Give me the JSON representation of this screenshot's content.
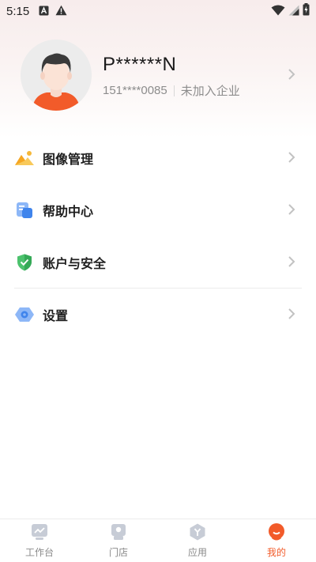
{
  "status_bar": {
    "time": "5:15",
    "left_icons": [
      "a-box-icon",
      "warning-icon"
    ],
    "right_icons": [
      "wifi-icon",
      "signal-icon",
      "battery-charging-icon"
    ]
  },
  "profile": {
    "name": "P******N",
    "phone": "151****0085",
    "company_status": "未加入企业"
  },
  "menu": {
    "items": [
      {
        "label": "图像管理",
        "icon": "image-icon",
        "color": "#f5b83a"
      },
      {
        "label": "帮助中心",
        "icon": "help-doc-icon",
        "color": "#4a8df0"
      },
      {
        "label": "账户与安全",
        "icon": "shield-icon",
        "color": "#3dbb5f"
      },
      {
        "label": "设置",
        "icon": "settings-icon",
        "color": "#4a8df0"
      }
    ]
  },
  "tab_bar": {
    "tabs": [
      {
        "label": "工作台",
        "icon": "workbench-icon",
        "active": false
      },
      {
        "label": "门店",
        "icon": "store-icon",
        "active": false
      },
      {
        "label": "应用",
        "icon": "apps-icon",
        "active": false
      },
      {
        "label": "我的",
        "icon": "profile-icon",
        "active": true
      }
    ],
    "active_color": "#f25b2a",
    "inactive_color": "#8a8a8a"
  }
}
